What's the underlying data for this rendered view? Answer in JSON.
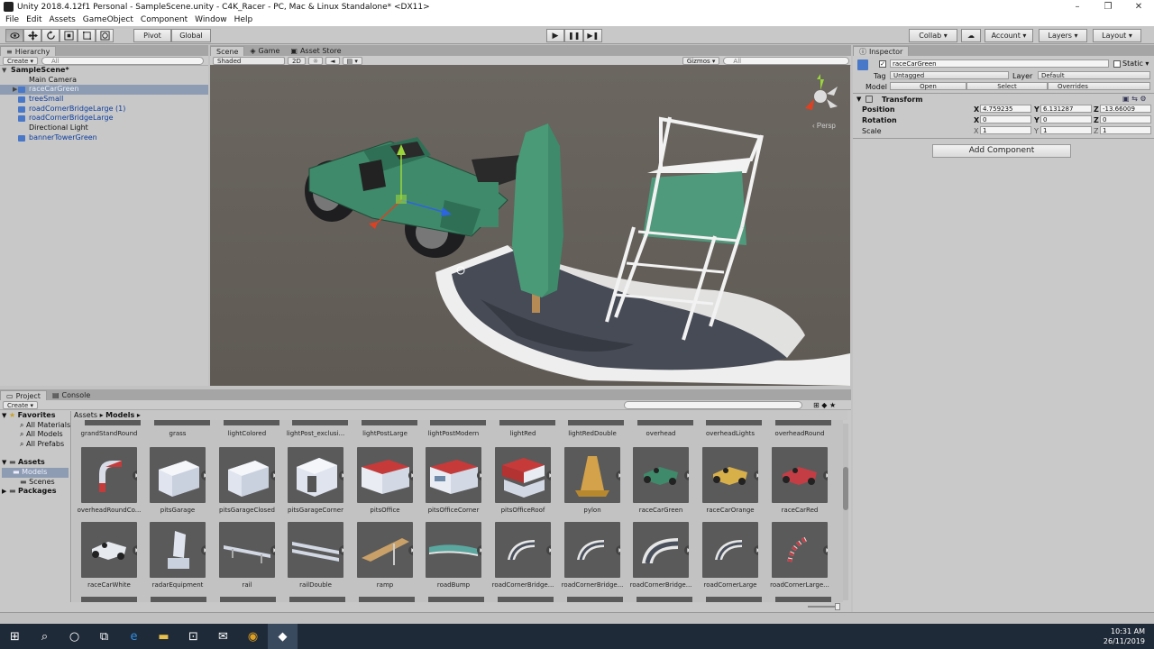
{
  "window": {
    "title": "Unity 2018.4.12f1 Personal - SampleScene.unity - C4K_Racer - PC, Mac & Linux Standalone* <DX11>"
  },
  "menu": [
    "File",
    "Edit",
    "Assets",
    "GameObject",
    "Component",
    "Window",
    "Help"
  ],
  "toolbar": {
    "pivot": "Pivot",
    "global": "Global",
    "collab": "Collab ▾",
    "account": "Account ▾",
    "layers": "Layers ▾",
    "layout": "Layout ▾"
  },
  "hierarchy": {
    "tab": "Hierarchy",
    "create": "Create ▾",
    "search": "All",
    "scene": "SampleScene*",
    "items": [
      {
        "label": "Main Camera",
        "style": "plain"
      },
      {
        "label": "raceCarGreen",
        "style": "selected"
      },
      {
        "label": "treeSmall",
        "style": "prefab"
      },
      {
        "label": "roadCornerBridgeLarge (1)",
        "style": "prefab"
      },
      {
        "label": "roadCornerBridgeLarge",
        "style": "prefab"
      },
      {
        "label": "Directional Light",
        "style": "plain"
      },
      {
        "label": "bannerTowerGreen",
        "style": "prefab"
      }
    ]
  },
  "scene_view": {
    "tabs": [
      "Scene",
      "Game",
      "Asset Store"
    ],
    "shading": "Shaded",
    "mode2d": "2D",
    "gizmos": "Gizmos ▾",
    "search": "All",
    "persp": "Persp"
  },
  "inspector": {
    "tab": "Inspector",
    "object_name": "raceCarGreen",
    "static_label": "Static ▾",
    "tag_label": "Tag",
    "tag_value": "Untagged",
    "layer_label": "Layer",
    "layer_value": "Default",
    "model_label": "Model",
    "open": "Open",
    "select": "Select",
    "overrides": "Overrides",
    "component_title": "Transform",
    "position_label": "Position",
    "rotation_label": "Rotation",
    "scale_label": "Scale",
    "axis_x": "X",
    "axis_y": "Y",
    "axis_z": "Z",
    "position": {
      "x": "4.759235",
      "y": "6.131287",
      "z": "-13.66009"
    },
    "rotation": {
      "x": "0",
      "y": "0",
      "z": "0"
    },
    "scale": {
      "x": "1",
      "y": "1",
      "z": "1"
    },
    "add_component": "Add Component"
  },
  "project": {
    "tabs": [
      "Project",
      "Console"
    ],
    "create": "Create ▾",
    "breadcrumb_root": "Assets",
    "breadcrumb_leaf": "Models",
    "favorites_title": "Favorites",
    "favorites": [
      "All Materials",
      "All Models",
      "All Prefabs"
    ],
    "assets_title": "Assets",
    "folders": [
      "Models",
      "Scenes"
    ],
    "packages_title": "Packages",
    "top_row": [
      "grandStandRound",
      "grass",
      "lightColored",
      "lightPost_exclusi...",
      "lightPostLarge",
      "lightPostModern",
      "lightRed",
      "lightRedDouble",
      "overhead",
      "overheadLights",
      "overheadRound"
    ],
    "row1": [
      "overheadRoundCo...",
      "pitsGarage",
      "pitsGarageClosed",
      "pitsGarageCorner",
      "pitsOffice",
      "pitsOfficeCorner",
      "pitsOfficeRoof",
      "pylon",
      "raceCarGreen",
      "raceCarOrange",
      "raceCarRed"
    ],
    "row2": [
      "raceCarWhite",
      "radarEquipment",
      "rail",
      "railDouble",
      "ramp",
      "roadBump",
      "roadCornerBridge...",
      "roadCornerBridge...",
      "roadCornerBridge...",
      "roadCornerLarge",
      "roadCornerLarge..."
    ]
  },
  "taskbar": {
    "time": "10:31 AM",
    "date": "26/11/2019"
  },
  "colors": {
    "car_green": "#3f8a6a",
    "banner_green": "#4f9a7c",
    "selection": "#8d9cb2",
    "prefab_blue": "#0d3d9e"
  }
}
